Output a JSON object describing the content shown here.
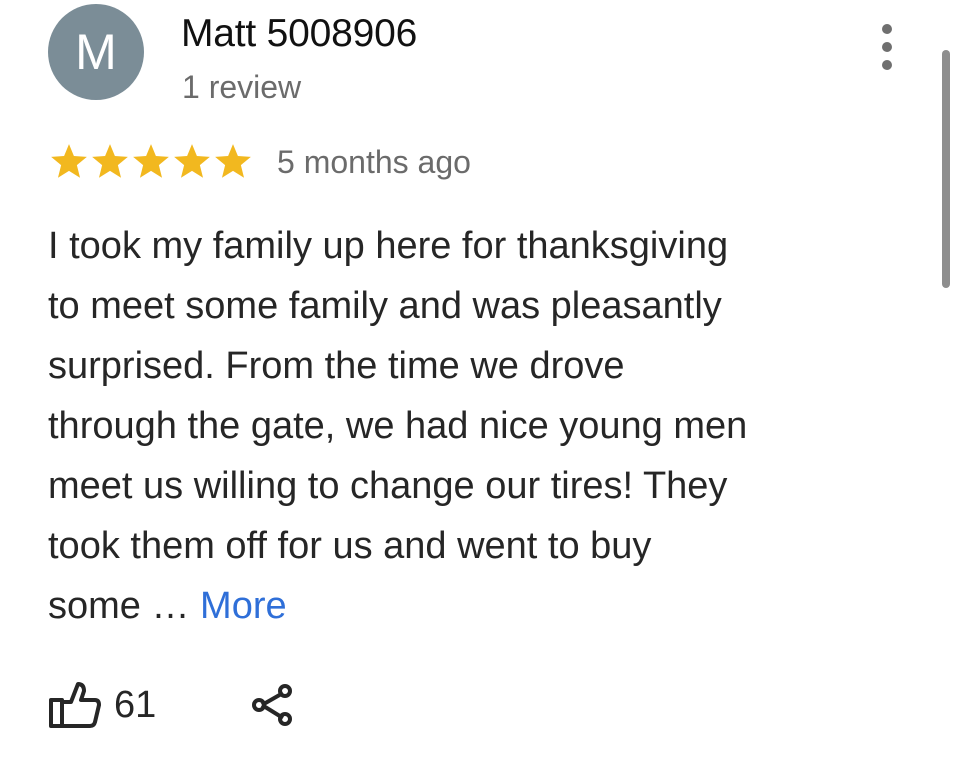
{
  "review": {
    "author": {
      "initial": "M",
      "name": "Matt 5008906",
      "review_count": "1 review",
      "avatar_color": "#7b8d97"
    },
    "rating": 5,
    "max_rating": 5,
    "star_color": "#f2b81f",
    "time": "5 months ago",
    "text_lines": [
      "I took my family up here for thanksgiving",
      "to meet some family and was pleasantly",
      "surprised. From the time we drove",
      "through the gate, we had nice young men",
      "meet us willing to change our tires! They",
      "took them off for us and went to buy",
      "some … "
    ],
    "more_label": "More",
    "more_color": "#2f6fd8",
    "likes": "61",
    "icons": {
      "menu": "more-vert-icon",
      "like": "thumbs-up-icon",
      "share": "share-icon"
    }
  }
}
